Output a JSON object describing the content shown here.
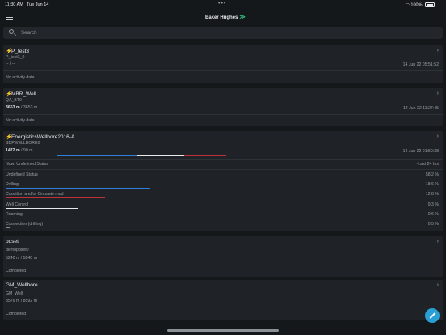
{
  "status_bar": {
    "time": "11:30 AM",
    "date": "Tue Jun 14",
    "battery": "100%"
  },
  "app": {
    "brand": "Baker Hughes"
  },
  "search": {
    "placeholder": "Search"
  },
  "wells": [
    {
      "name": "P_test3",
      "sub": "P_test3_0",
      "depth": "-- / --",
      "timestamp": "14 Jun 22 05:51:52",
      "activity": "No activity data"
    },
    {
      "name": "MBR_Well",
      "sub": "QA_BT0",
      "depth_bold": "3653 m",
      "depth_rest": " / 3653 m",
      "timestamp": "14 Jun 22 11:27:45",
      "activity": "No activity data"
    },
    {
      "name": "EnergisticsWellbore2016-A",
      "sub": "SDPWELLBORE0",
      "depth_bold": "1472 m",
      "depth_rest": " / 90 m",
      "timestamp": "14 Jun 22 01:50:38",
      "now_status": "Now: Undefined Status",
      "window": "Last 24 hrs",
      "activities": [
        {
          "label": "Undefined Status",
          "pct": "58.2 %",
          "value": 58.2,
          "color": "#7a7f84"
        },
        {
          "label": "Drilling",
          "pct": "18.6 %",
          "value": 18.6,
          "color": "#2f7fd8"
        },
        {
          "label": "Condition and/or Circulate mud",
          "pct": "12.8 %",
          "value": 12.8,
          "color": "#c0303a"
        },
        {
          "label": "Well Control",
          "pct": "9.3 %",
          "value": 9.3,
          "color": "#e6e8ea"
        },
        {
          "label": "Reaming",
          "pct": "0.6 %",
          "value": 0.6,
          "color": "#8a8f94"
        },
        {
          "label": "Connection (drilling)",
          "pct": "0.5 %",
          "value": 0.5,
          "color": "#8a8f94"
        }
      ]
    },
    {
      "name": "pdset",
      "sub": "demopdset0",
      "depth": "5240 m / 5240 m",
      "activity": "Completed"
    },
    {
      "name": "GM_Wellbore",
      "sub": "GM_Well",
      "depth": "8576 m / 8592 m",
      "activity": "Completed"
    }
  ]
}
